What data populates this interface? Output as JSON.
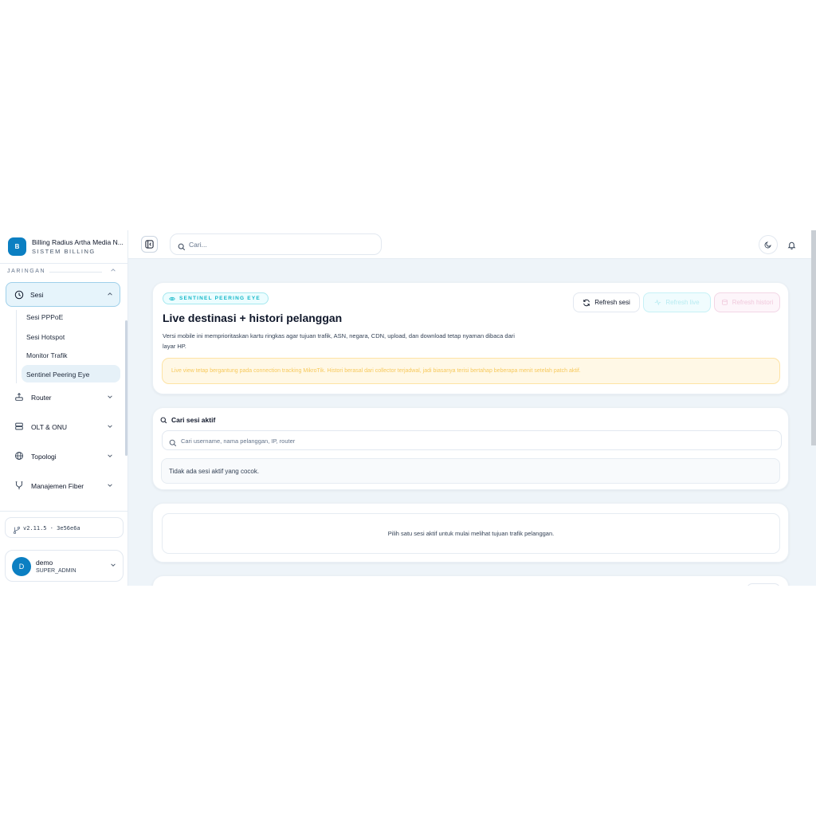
{
  "brand": {
    "logo_letter": "B",
    "name": "Billing Radius Artha Media N...",
    "subtitle": "SISTEM BILLING"
  },
  "sidebar": {
    "section_label": "JARINGAN",
    "active_group": {
      "label": "Sesi",
      "icon": "clock-icon"
    },
    "sub_items": [
      {
        "label": "Sesi PPPoE"
      },
      {
        "label": "Sesi Hotspot"
      },
      {
        "label": "Monitor Trafik"
      },
      {
        "label": "Sentinel Peering Eye",
        "active": true
      }
    ],
    "groups": [
      {
        "label": "Router",
        "icon": "router-icon"
      },
      {
        "label": "OLT & ONU",
        "icon": "server-icon"
      },
      {
        "label": "Topologi",
        "icon": "globe-icon"
      },
      {
        "label": "Manajemen Fiber",
        "icon": "cable-icon"
      }
    ],
    "version": "v2.11.5 · 3e56e6a",
    "user": {
      "avatar_letter": "D",
      "name": "demo",
      "role": "SUPER_ADMIN"
    }
  },
  "topbar": {
    "search_placeholder": "Cari..."
  },
  "hero": {
    "badge": "SENTINEL PEERING EYE",
    "title": "Live destinasi + histori pelanggan",
    "description": "Versi mobile ini memprioritaskan kartu ringkas agar tujuan trafik, ASN, negara, CDN, upload, dan download tetap nyaman dibaca dari layar HP.",
    "buttons": {
      "refresh": "Refresh sesi",
      "live": "Refresh live",
      "history": "Refresh histori"
    },
    "notice": "Live view tetap bergantung pada connection tracking MikroTik. Histori berasal dari collector terjadwal, jadi biasanya terisi bertahap beberapa menit setelah patch aktif."
  },
  "session_search": {
    "label": "Cari sesi aktif",
    "placeholder": "Cari username, nama pelanggan, IP, router",
    "empty_text": "Tidak ada sesi aktif yang cocok."
  },
  "destination_panel": {
    "empty_text": "Pilih satu sesi aktif untuk mulai melihat tujuan trafik pelanggan."
  },
  "colors": {
    "accent": "#0b7fc2",
    "cyan": "#14b8c8",
    "warning_bg": "#fff8e6"
  }
}
